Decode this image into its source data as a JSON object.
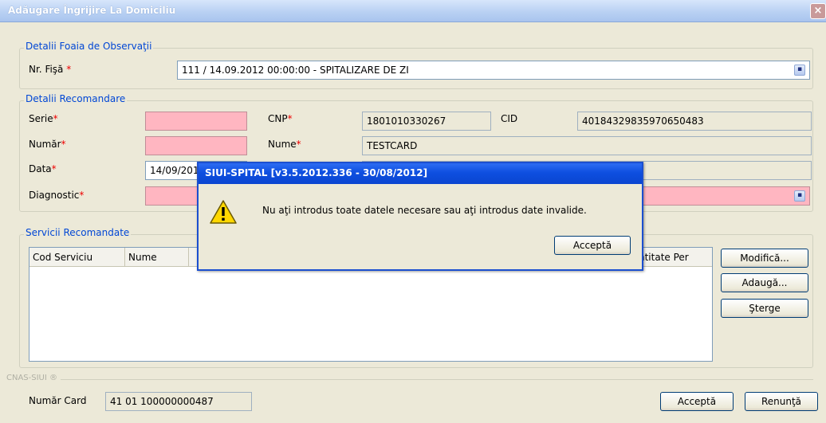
{
  "window": {
    "title": "Adăugare Îngrijire La Domiciliu",
    "close_label": "×"
  },
  "observatie": {
    "legend": "Detalii Foaia de Observaţii",
    "fisa_label": "Nr. Fişă",
    "fisa_value": "111 / 14.09.2012 00:00:00 - SPITALIZARE DE ZI"
  },
  "recomandare": {
    "legend": "Detalii Recomandare",
    "serie_label": "Serie",
    "serie_value": "",
    "numar_label": "Număr",
    "numar_value": "",
    "data_label": "Data",
    "data_value": "14/09/201",
    "diagnostic_label": "Diagnostic",
    "diagnostic_value": "",
    "cnp_label": "CNP",
    "cnp_value": "1801010330267",
    "cid_label": "CID",
    "cid_value": "40184329835970650483",
    "nume_label": "Nume",
    "nume_value": "TESTCARD"
  },
  "servicii": {
    "legend": "Servicii Recomandate",
    "columns": [
      "Cod Serviciu",
      "Nume",
      "ntitate Per"
    ],
    "rows": [],
    "modifica_label": "Modifică...",
    "adauga_label": "Adaugă...",
    "sterge_label": "Şterge"
  },
  "cnas": {
    "legend": "CNAS-SIUI ®",
    "card_label": "Număr Card",
    "card_value": "41 01 100000000487"
  },
  "footer": {
    "accepta_label": "Acceptă",
    "renunta_label": "Renunţă"
  },
  "dialog": {
    "title": "SIUI-SPITAL [v3.5.2012.336 - 30/08/2012]",
    "message": "Nu aţi introdus toate datele necesare sau aţi introdus date invalide.",
    "ok_label": "Acceptă",
    "icon": "warning-icon"
  },
  "required_marker": "*",
  "dropdown_glyph": "▪"
}
